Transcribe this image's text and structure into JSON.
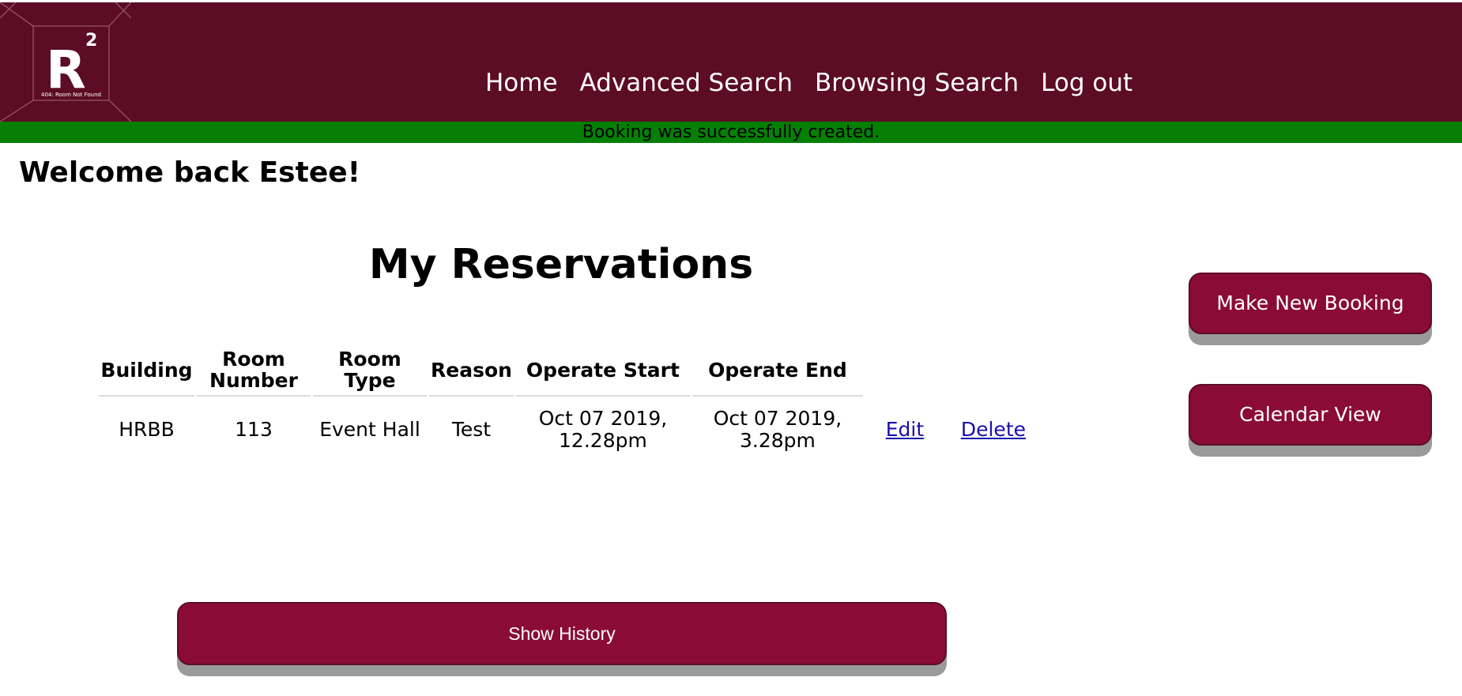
{
  "header": {
    "logo": {
      "letter": "R",
      "superscript": "2",
      "tagline": "404: Room Not Found"
    },
    "nav": [
      {
        "label": "Home"
      },
      {
        "label": "Advanced Search"
      },
      {
        "label": "Browsing Search"
      },
      {
        "label": "Log out"
      }
    ],
    "colors": {
      "bar": "#5c0c25",
      "accent": "#8a0c36",
      "flash": "#058005"
    }
  },
  "flash": {
    "message": "Booking was successfully created."
  },
  "welcome": "Welcome back Estee!",
  "reservations": {
    "title": "My Reservations",
    "columns": [
      "Building",
      "Room Number",
      "Room Type",
      "Reason",
      "Operate Start",
      "Operate End"
    ],
    "rows": [
      {
        "building": "HRBB",
        "room_number": "113",
        "room_type": "Event Hall",
        "reason": "Test",
        "operate_start": "Oct 07 2019, 12.28pm",
        "operate_end": "Oct 07 2019, 3.28pm",
        "edit_label": "Edit",
        "delete_label": "Delete"
      }
    ]
  },
  "actions": {
    "new_booking": "Make New Booking",
    "calendar": "Calendar View",
    "history": "Show History"
  }
}
